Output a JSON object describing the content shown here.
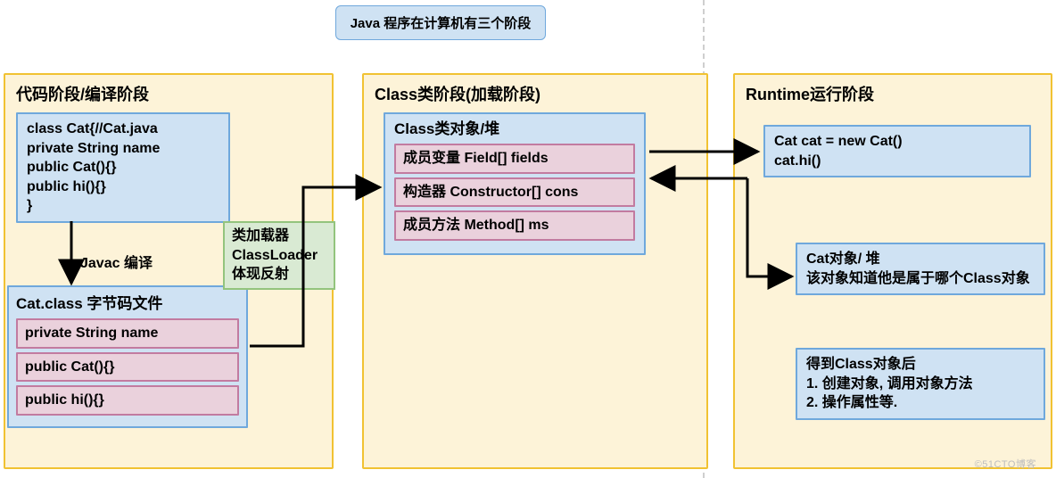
{
  "title": "Java 程序在计算机有三个阶段",
  "stage1": {
    "label": "代码阶段/编译阶段",
    "source_code": "class Cat{//Cat.java\nprivate String name\npublic Cat(){}\npublic hi(){}\n}",
    "compile_label": "Javac 编译",
    "bytecode_header": "Cat.class 字节码文件",
    "bytecode_items": [
      "private String name",
      "public Cat(){}",
      "public hi(){}"
    ],
    "classloader_box": "类加载器\nClassLoader\n体现反射"
  },
  "stage2": {
    "label": "Class类阶段(加载阶段)",
    "heap_header": "Class类对象/堆",
    "heap_items": [
      "成员变量 Field[] fields",
      "构造器 Constructor[] cons",
      "成员方法 Method[] ms"
    ]
  },
  "stage3": {
    "label": "Runtime运行阶段",
    "code_box": "Cat cat = new Cat()\ncat.hi()",
    "obj_box": "Cat对象/ 堆\n该对象知道他是属于哪个Class对象",
    "post_box": "得到Class对象后\n1. 创建对象, 调用对象方法\n2. 操作属性等."
  },
  "watermark": "©51CTO博客"
}
